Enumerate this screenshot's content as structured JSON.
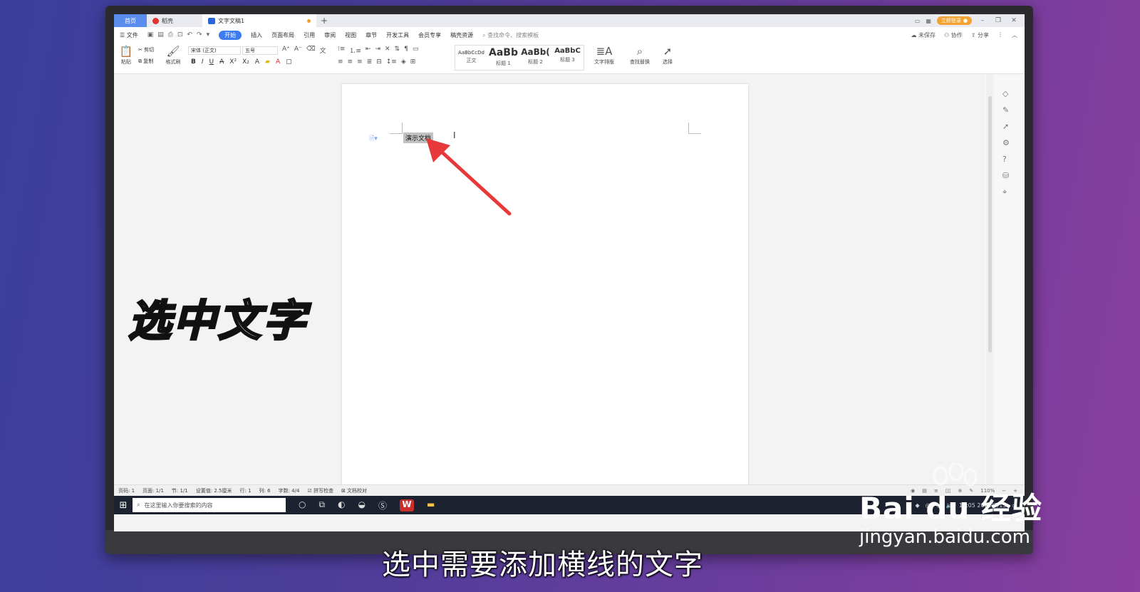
{
  "tabs": [
    {
      "label": "首页"
    },
    {
      "label": "稻壳"
    },
    {
      "label": "文字文稿1"
    }
  ],
  "tab_new": "+",
  "login_button": "立即登录",
  "menu": {
    "file": "文件",
    "items": [
      "开始",
      "插入",
      "页面布局",
      "引用",
      "审阅",
      "视图",
      "章节",
      "开发工具",
      "会员专享",
      "稿壳资源"
    ],
    "search": "查找命令、搜索模板",
    "right": [
      "未保存",
      "协作",
      "分享"
    ]
  },
  "ribbon": {
    "paste": "粘贴",
    "cut": "剪切",
    "copy": "复制",
    "format_painter": "格式刷",
    "font_name": "宋体 (正文)",
    "font_size": "五号",
    "format_buttons": [
      "B",
      "I",
      "U",
      "A",
      "X²",
      "X₂",
      "A"
    ],
    "styles": [
      {
        "sample": "AaBbCcDd",
        "name": "正文"
      },
      {
        "sample": "AaBb",
        "name": "标题 1"
      },
      {
        "sample": "AaBb(",
        "name": "标题 2"
      },
      {
        "sample": "AaBbC",
        "name": "标题 3"
      }
    ],
    "text_layout": "文字排版",
    "find_replace": "查找替换",
    "select": "选择"
  },
  "document": {
    "selected_text": "演示文档"
  },
  "status": {
    "items": [
      "页码: 1",
      "页面: 1/1",
      "节: 1/1",
      "设置值: 2.5厘米",
      "行: 1",
      "列: 6",
      "字数: 4/4",
      "拼写检查",
      "文档校对"
    ],
    "zoom": "110%"
  },
  "taskbar": {
    "search_placeholder": "在这里输入你要搜索的内容",
    "time": "11:05",
    "date": "2022/7/15"
  },
  "overlay": {
    "big_caption": "选中文字",
    "subtitle": "选中需要添加横线的文字",
    "watermark_brand": "Bai du 经验",
    "watermark_url": "jingyan.baidu.com"
  }
}
